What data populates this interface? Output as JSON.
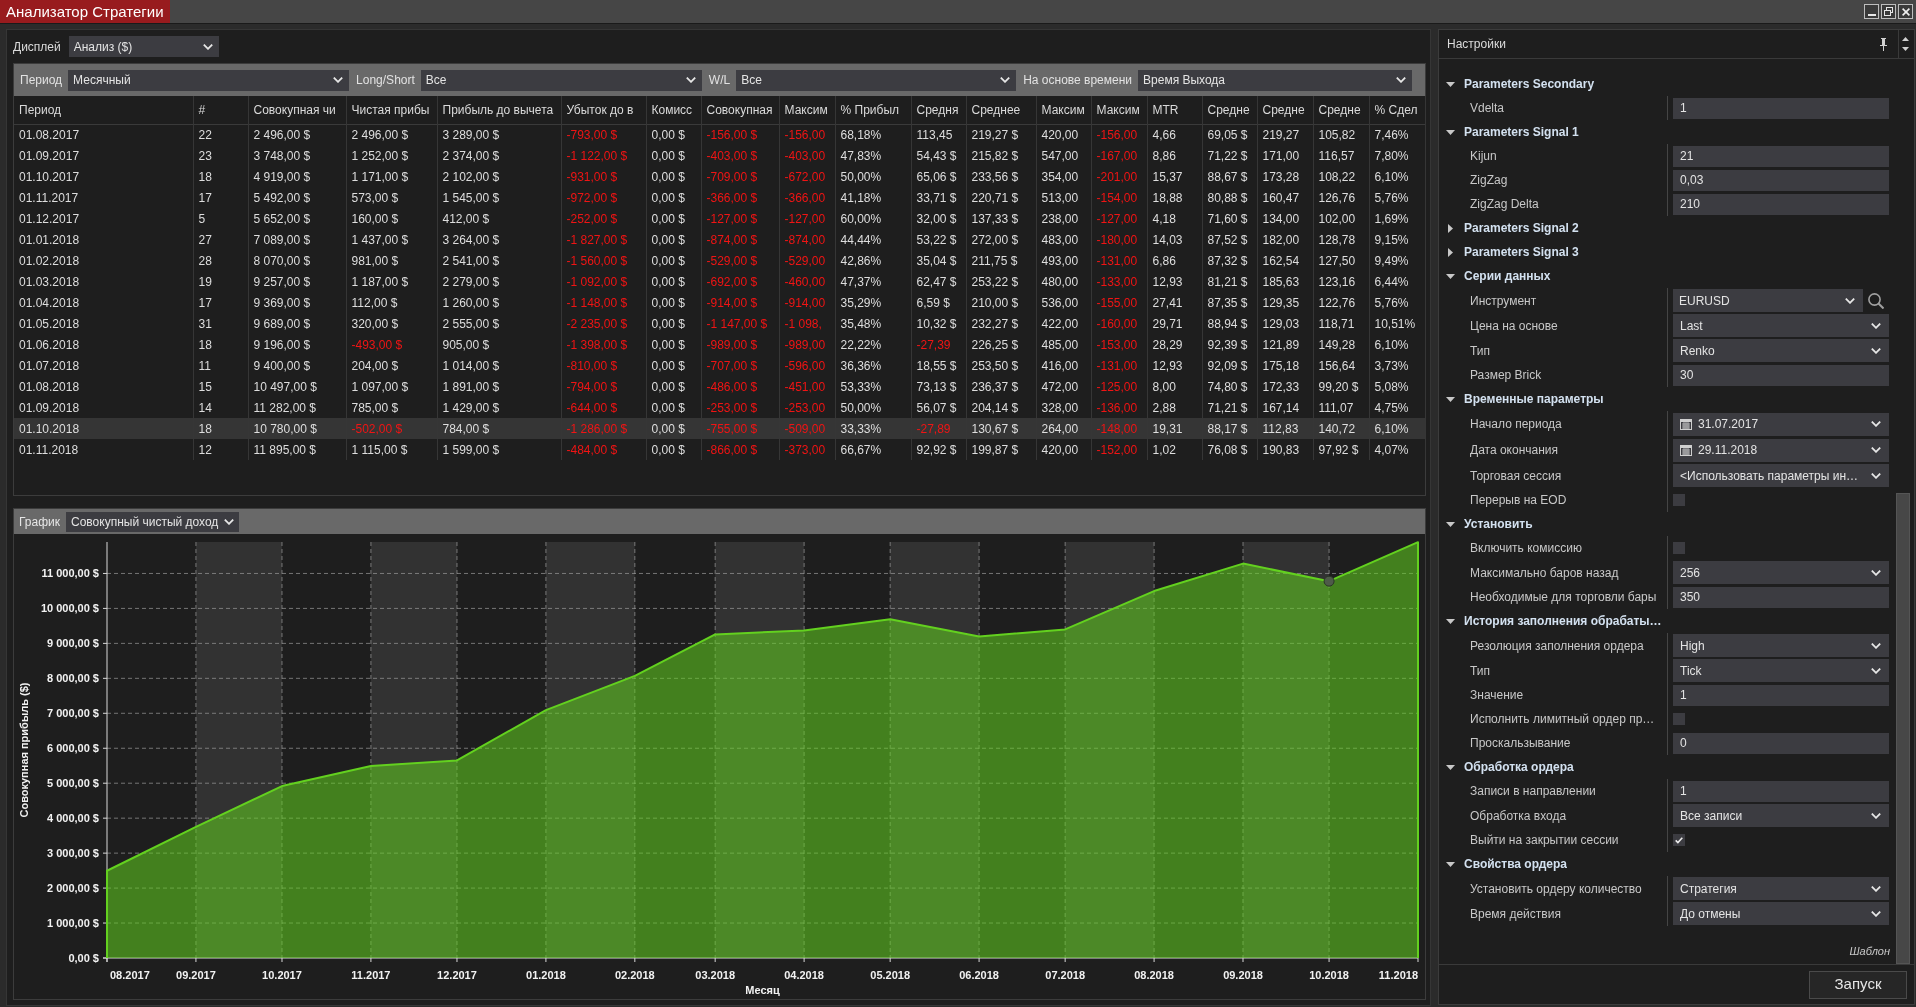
{
  "window": {
    "title": "Анализатор Стратегии"
  },
  "display": {
    "label": "Дисплей",
    "value": "Анализ ($)"
  },
  "filters": [
    {
      "label": "Период",
      "value": "Месячный"
    },
    {
      "label": "Long/Short",
      "value": "Все"
    },
    {
      "label": "W/L",
      "value": "Все"
    },
    {
      "label": "На основе времени",
      "value": "Время Выхода"
    }
  ],
  "table": {
    "columns": [
      "Период",
      "#",
      "Совокупная чи",
      "Чистая прибы",
      "Прибыль до вычета",
      "Убыток до в",
      "Комисс",
      "Совокупная",
      "Максим",
      "% Прибыл",
      "Средня",
      "Среднее",
      "Максим",
      "Максим",
      "MTR",
      "Средне",
      "Средне",
      "Средне",
      "% Сдел"
    ],
    "rows": [
      {
        "selected": false,
        "cells": [
          "01.08.2017",
          "22",
          "2 496,00 $",
          "2 496,00 $",
          "3 289,00 $",
          "-793,00 $",
          "0,00 $",
          "-156,00 $",
          "-156,00",
          "68,18%",
          "113,45",
          "219,27 $",
          "420,00",
          "-156,00",
          "4,66",
          "69,05 $",
          "219,27",
          "105,82",
          "7,46%"
        ],
        "negative": [
          false,
          false,
          false,
          false,
          false,
          true,
          false,
          true,
          true,
          false,
          false,
          false,
          false,
          true,
          false,
          false,
          false,
          false,
          false
        ]
      },
      {
        "selected": false,
        "cells": [
          "01.09.2017",
          "23",
          "3 748,00 $",
          "1 252,00 $",
          "2 374,00 $",
          "-1 122,00 $",
          "0,00 $",
          "-403,00 $",
          "-403,00",
          "47,83%",
          "54,43 $",
          "215,82 $",
          "547,00",
          "-167,00",
          "8,86",
          "71,22 $",
          "171,00",
          "116,57",
          "7,80%"
        ],
        "negative": [
          false,
          false,
          false,
          false,
          false,
          true,
          false,
          true,
          true,
          false,
          false,
          false,
          false,
          true,
          false,
          false,
          false,
          false,
          false
        ]
      },
      {
        "selected": false,
        "cells": [
          "01.10.2017",
          "18",
          "4 919,00 $",
          "1 171,00 $",
          "2 102,00 $",
          "-931,00 $",
          "0,00 $",
          "-709,00 $",
          "-672,00",
          "50,00%",
          "65,06 $",
          "233,56 $",
          "354,00",
          "-201,00",
          "15,37",
          "88,67 $",
          "173,28",
          "108,22",
          "6,10%"
        ],
        "negative": [
          false,
          false,
          false,
          false,
          false,
          true,
          false,
          true,
          true,
          false,
          false,
          false,
          false,
          true,
          false,
          false,
          false,
          false,
          false
        ]
      },
      {
        "selected": false,
        "cells": [
          "01.11.2017",
          "17",
          "5 492,00 $",
          "573,00 $",
          "1 545,00 $",
          "-972,00 $",
          "0,00 $",
          "-366,00 $",
          "-366,00",
          "41,18%",
          "33,71 $",
          "220,71 $",
          "513,00",
          "-154,00",
          "18,88",
          "80,88 $",
          "160,47",
          "126,76",
          "5,76%"
        ],
        "negative": [
          false,
          false,
          false,
          false,
          false,
          true,
          false,
          true,
          true,
          false,
          false,
          false,
          false,
          true,
          false,
          false,
          false,
          false,
          false
        ]
      },
      {
        "selected": false,
        "cells": [
          "01.12.2017",
          "5",
          "5 652,00 $",
          "160,00 $",
          "412,00 $",
          "-252,00 $",
          "0,00 $",
          "-127,00 $",
          "-127,00",
          "60,00%",
          "32,00 $",
          "137,33 $",
          "238,00",
          "-127,00",
          "4,18",
          "71,60 $",
          "134,00",
          "102,00",
          "1,69%"
        ],
        "negative": [
          false,
          false,
          false,
          false,
          false,
          true,
          false,
          true,
          true,
          false,
          false,
          false,
          false,
          true,
          false,
          false,
          false,
          false,
          false
        ]
      },
      {
        "selected": false,
        "cells": [
          "01.01.2018",
          "27",
          "7 089,00 $",
          "1 437,00 $",
          "3 264,00 $",
          "-1 827,00 $",
          "0,00 $",
          "-874,00 $",
          "-874,00",
          "44,44%",
          "53,22 $",
          "272,00 $",
          "483,00",
          "-180,00",
          "14,03",
          "87,52 $",
          "182,00",
          "128,78",
          "9,15%"
        ],
        "negative": [
          false,
          false,
          false,
          false,
          false,
          true,
          false,
          true,
          true,
          false,
          false,
          false,
          false,
          true,
          false,
          false,
          false,
          false,
          false
        ]
      },
      {
        "selected": false,
        "cells": [
          "01.02.2018",
          "28",
          "8 070,00 $",
          "981,00 $",
          "2 541,00 $",
          "-1 560,00 $",
          "0,00 $",
          "-529,00 $",
          "-529,00",
          "42,86%",
          "35,04 $",
          "211,75 $",
          "493,00",
          "-131,00",
          "6,86",
          "87,32 $",
          "162,54",
          "127,50",
          "9,49%"
        ],
        "negative": [
          false,
          false,
          false,
          false,
          false,
          true,
          false,
          true,
          true,
          false,
          false,
          false,
          false,
          true,
          false,
          false,
          false,
          false,
          false
        ]
      },
      {
        "selected": false,
        "cells": [
          "01.03.2018",
          "19",
          "9 257,00 $",
          "1 187,00 $",
          "2 279,00 $",
          "-1 092,00 $",
          "0,00 $",
          "-692,00 $",
          "-460,00",
          "47,37%",
          "62,47 $",
          "253,22 $",
          "480,00",
          "-133,00",
          "12,93",
          "81,21 $",
          "185,63",
          "123,16",
          "6,44%"
        ],
        "negative": [
          false,
          false,
          false,
          false,
          false,
          true,
          false,
          true,
          true,
          false,
          false,
          false,
          false,
          true,
          false,
          false,
          false,
          false,
          false
        ]
      },
      {
        "selected": false,
        "cells": [
          "01.04.2018",
          "17",
          "9 369,00 $",
          "112,00 $",
          "1 260,00 $",
          "-1 148,00 $",
          "0,00 $",
          "-914,00 $",
          "-914,00",
          "35,29%",
          "6,59 $",
          "210,00 $",
          "536,00",
          "-155,00",
          "27,41",
          "87,35 $",
          "129,35",
          "122,76",
          "5,76%"
        ],
        "negative": [
          false,
          false,
          false,
          false,
          false,
          true,
          false,
          true,
          true,
          false,
          false,
          false,
          false,
          true,
          false,
          false,
          false,
          false,
          false
        ]
      },
      {
        "selected": false,
        "cells": [
          "01.05.2018",
          "31",
          "9 689,00 $",
          "320,00 $",
          "2 555,00 $",
          "-2 235,00 $",
          "0,00 $",
          "-1 147,00 $",
          "-1 098,",
          "35,48%",
          "10,32 $",
          "232,27 $",
          "422,00",
          "-160,00",
          "29,71",
          "88,94 $",
          "129,03",
          "118,71",
          "10,51%"
        ],
        "negative": [
          false,
          false,
          false,
          false,
          false,
          true,
          false,
          true,
          true,
          false,
          false,
          false,
          false,
          true,
          false,
          false,
          false,
          false,
          false
        ]
      },
      {
        "selected": false,
        "cells": [
          "01.06.2018",
          "18",
          "9 196,00 $",
          "-493,00 $",
          "905,00 $",
          "-1 398,00 $",
          "0,00 $",
          "-989,00 $",
          "-989,00",
          "22,22%",
          "-27,39",
          "226,25 $",
          "485,00",
          "-153,00",
          "28,29",
          "92,39 $",
          "121,89",
          "149,28",
          "6,10%"
        ],
        "negative": [
          false,
          false,
          false,
          true,
          false,
          true,
          false,
          true,
          true,
          false,
          true,
          false,
          false,
          true,
          false,
          false,
          false,
          false,
          false
        ]
      },
      {
        "selected": false,
        "cells": [
          "01.07.2018",
          "11",
          "9 400,00 $",
          "204,00 $",
          "1 014,00 $",
          "-810,00 $",
          "0,00 $",
          "-707,00 $",
          "-596,00",
          "36,36%",
          "18,55 $",
          "253,50 $",
          "416,00",
          "-131,00",
          "12,93",
          "92,09 $",
          "175,18",
          "156,64",
          "3,73%"
        ],
        "negative": [
          false,
          false,
          false,
          false,
          false,
          true,
          false,
          true,
          true,
          false,
          false,
          false,
          false,
          true,
          false,
          false,
          false,
          false,
          false
        ]
      },
      {
        "selected": false,
        "cells": [
          "01.08.2018",
          "15",
          "10 497,00 $",
          "1 097,00 $",
          "1 891,00 $",
          "-794,00 $",
          "0,00 $",
          "-486,00 $",
          "-451,00",
          "53,33%",
          "73,13 $",
          "236,37 $",
          "472,00",
          "-125,00",
          "8,00",
          "74,80 $",
          "172,33",
          "99,20 $",
          "5,08%"
        ],
        "negative": [
          false,
          false,
          false,
          false,
          false,
          true,
          false,
          true,
          true,
          false,
          false,
          false,
          false,
          true,
          false,
          false,
          false,
          false,
          false
        ]
      },
      {
        "selected": false,
        "cells": [
          "01.09.2018",
          "14",
          "11 282,00 $",
          "785,00 $",
          "1 429,00 $",
          "-644,00 $",
          "0,00 $",
          "-253,00 $",
          "-253,00",
          "50,00%",
          "56,07 $",
          "204,14 $",
          "328,00",
          "-136,00",
          "2,88",
          "71,21 $",
          "167,14",
          "111,07",
          "4,75%"
        ],
        "negative": [
          false,
          false,
          false,
          false,
          false,
          true,
          false,
          true,
          true,
          false,
          false,
          false,
          false,
          true,
          false,
          false,
          false,
          false,
          false
        ]
      },
      {
        "selected": true,
        "cells": [
          "01.10.2018",
          "18",
          "10 780,00 $",
          "-502,00 $",
          "784,00 $",
          "-1 286,00 $",
          "0,00 $",
          "-755,00 $",
          "-509,00",
          "33,33%",
          "-27,89",
          "130,67 $",
          "264,00",
          "-148,00",
          "19,31",
          "88,17 $",
          "112,83",
          "140,72",
          "6,10%"
        ],
        "negative": [
          false,
          false,
          false,
          true,
          false,
          true,
          false,
          true,
          true,
          false,
          true,
          false,
          false,
          true,
          false,
          false,
          false,
          false,
          false
        ]
      },
      {
        "selected": false,
        "cells": [
          "01.11.2018",
          "12",
          "11 895,00 $",
          "1 115,00 $",
          "1 599,00 $",
          "-484,00 $",
          "0,00 $",
          "-866,00 $",
          "-373,00",
          "66,67%",
          "92,92 $",
          "199,87 $",
          "420,00",
          "-152,00",
          "1,02",
          "76,08 $",
          "190,83",
          "97,92 $",
          "4,07%"
        ],
        "negative": [
          false,
          false,
          false,
          false,
          false,
          true,
          false,
          true,
          true,
          false,
          false,
          false,
          false,
          true,
          false,
          false,
          false,
          false,
          false
        ]
      }
    ]
  },
  "chart_panel": {
    "label": "График",
    "value": "Совокупный чистый доход",
    "chart_data": {
      "type": "area",
      "xlabel": "Месяц",
      "ylabel": "Совокупная прибыль ($)",
      "color": "#63d11f",
      "grid": true,
      "x": [
        "2017-08-01",
        "2017-09-01",
        "2017-10-01",
        "2017-11-01",
        "2017-12-01",
        "2018-01-01",
        "2018-02-01",
        "2018-03-01",
        "2018-04-01",
        "2018-05-01",
        "2018-06-01",
        "2018-07-01",
        "2018-08-01",
        "2018-09-01",
        "2018-10-01",
        "2018-11-01"
      ],
      "values": [
        2496,
        3748,
        4919,
        5492,
        5652,
        7089,
        8070,
        9257,
        9369,
        9689,
        9196,
        9400,
        10497,
        11282,
        10780,
        11895
      ],
      "xlim": [
        "2017-08-01",
        "2018-11-01"
      ],
      "ylim": [
        0,
        11900
      ],
      "xticks": [
        {
          "value": "2017-08-01",
          "label": "08.2017"
        },
        {
          "value": "2017-09-01",
          "label": "09.2017"
        },
        {
          "value": "2017-10-01",
          "label": "10.2017"
        },
        {
          "value": "2017-11-01",
          "label": "11.2017"
        },
        {
          "value": "2017-12-01",
          "label": "12.2017"
        },
        {
          "value": "2018-01-01",
          "label": "01.2018"
        },
        {
          "value": "2018-02-01",
          "label": "02.2018"
        },
        {
          "value": "2018-03-01",
          "label": "03.2018"
        },
        {
          "value": "2018-04-01",
          "label": "04.2018"
        },
        {
          "value": "2018-05-01",
          "label": "05.2018"
        },
        {
          "value": "2018-06-01",
          "label": "06.2018"
        },
        {
          "value": "2018-07-01",
          "label": "07.2018"
        },
        {
          "value": "2018-08-01",
          "label": "08.2018"
        },
        {
          "value": "2018-09-01",
          "label": "09.2018"
        },
        {
          "value": "2018-10-01",
          "label": "10.2018"
        },
        {
          "value": "2018-11-01",
          "label": "11.2018"
        }
      ],
      "yticks": [
        {
          "value": 0,
          "label": "0,00 $"
        },
        {
          "value": 1000,
          "label": "1 000,00 $"
        },
        {
          "value": 2000,
          "label": "2 000,00 $"
        },
        {
          "value": 3000,
          "label": "3 000,00 $"
        },
        {
          "value": 4000,
          "label": "4 000,00 $"
        },
        {
          "value": 5000,
          "label": "5 000,00 $"
        },
        {
          "value": 6000,
          "label": "6 000,00 $"
        },
        {
          "value": 7000,
          "label": "7 000,00 $"
        },
        {
          "value": 8000,
          "label": "8 000,00 $"
        },
        {
          "value": 9000,
          "label": "9 000,00 $"
        },
        {
          "value": 10000,
          "label": "10 000,00 $"
        },
        {
          "value": 11000,
          "label": "11 000,00 $"
        }
      ]
    }
  },
  "settings": {
    "title": "Настройки",
    "sections": [
      {
        "title": "Parameters Secondary",
        "expanded": true,
        "properties": [
          {
            "label": "Vdelta",
            "kind": "text",
            "value": "1"
          }
        ]
      },
      {
        "title": "Parameters Signal 1",
        "expanded": true,
        "properties": [
          {
            "label": "Kijun",
            "kind": "text",
            "value": "21"
          },
          {
            "label": "ZigZag",
            "kind": "text",
            "value": "0,03"
          },
          {
            "label": "ZigZag Delta",
            "kind": "text",
            "value": "210"
          }
        ]
      },
      {
        "title": "Parameters Signal 2",
        "expanded": false
      },
      {
        "title": "Parameters Signal 3",
        "expanded": false
      },
      {
        "title": "Серии данных",
        "expanded": true,
        "properties": [
          {
            "label": "Инструмент",
            "kind": "lookup",
            "value": "EURUSD"
          },
          {
            "label": "Цена на основе",
            "kind": "select",
            "value": "Last"
          },
          {
            "label": "Тип",
            "kind": "select",
            "value": "Renko"
          },
          {
            "label": "Размер Brick",
            "kind": "text",
            "value": "30"
          }
        ]
      },
      {
        "title": "Временные параметры",
        "expanded": true,
        "properties": [
          {
            "label": "Начало периода",
            "kind": "date",
            "value": "31.07.2017"
          },
          {
            "label": "Дата окончания",
            "kind": "date",
            "value": "29.11.2018"
          },
          {
            "label": "Торговая сессия",
            "kind": "select",
            "value": "<Использовать параметры ин…"
          },
          {
            "label": "Перерыв на EOD",
            "kind": "checkbox",
            "checked": false
          }
        ]
      },
      {
        "title": "Установить",
        "expanded": true,
        "properties": [
          {
            "label": "Включить комиссию",
            "kind": "checkbox",
            "checked": false
          },
          {
            "label": "Максимально баров назад",
            "kind": "select",
            "value": "256"
          },
          {
            "label": "Необходимые для торговли бары",
            "kind": "text",
            "value": "350"
          }
        ]
      },
      {
        "title": "История заполнения обрабаты…",
        "expanded": true,
        "properties": [
          {
            "label": "Резолюция заполнения ордера",
            "kind": "select",
            "value": "High"
          },
          {
            "label": "Тип",
            "kind": "select",
            "value": "Tick"
          },
          {
            "label": "Значение",
            "kind": "text",
            "value": "1"
          },
          {
            "label": "Исполнить лимитный ордер пр…",
            "kind": "checkbox",
            "checked": false
          },
          {
            "label": "Проскальзывание",
            "kind": "text",
            "value": "0"
          }
        ]
      },
      {
        "title": "Обработка ордера",
        "expanded": true,
        "properties": [
          {
            "label": "Записи в направлении",
            "kind": "text",
            "value": "1"
          },
          {
            "label": "Обработка входа",
            "kind": "select",
            "value": "Все записи"
          },
          {
            "label": "Выйти на закрытии сессии",
            "kind": "checkbox",
            "checked": true
          }
        ]
      },
      {
        "title": "Свойства ордера",
        "expanded": true,
        "properties": [
          {
            "label": "Установить ордеру количество",
            "kind": "select",
            "value": "Стратегия"
          },
          {
            "label": "Время действия",
            "kind": "select",
            "value": "До отмены"
          }
        ]
      }
    ],
    "template_link": "Шаблон",
    "run_button": "Запуск"
  }
}
